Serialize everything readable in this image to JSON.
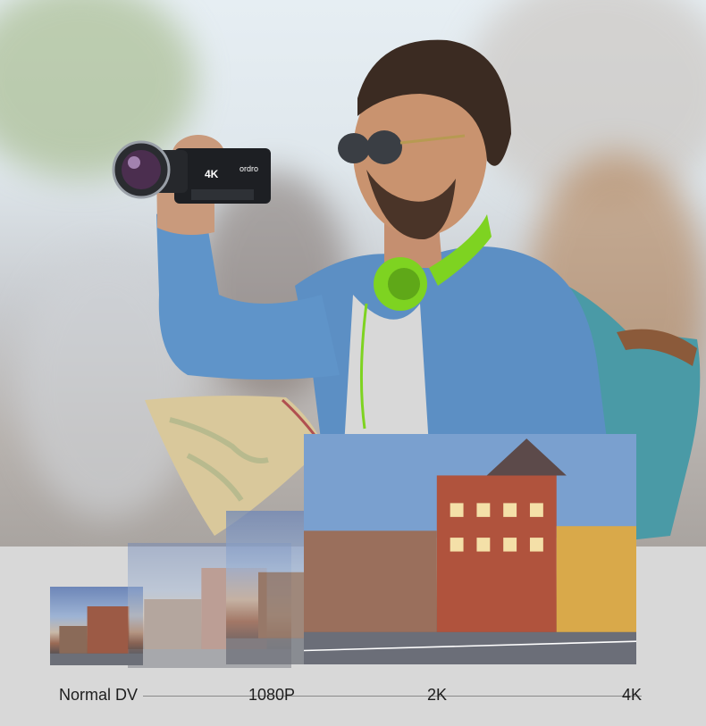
{
  "labels": {
    "normal": "Normal DV",
    "p1080": "1080P",
    "k2": "2K",
    "k4": "4K"
  },
  "camera_text": {
    "brand": "ordro",
    "res": "4K"
  },
  "colors": {
    "headphone": "#7ed321",
    "jacket": "#5c8fc4",
    "backpack": "#4a9aa6"
  }
}
